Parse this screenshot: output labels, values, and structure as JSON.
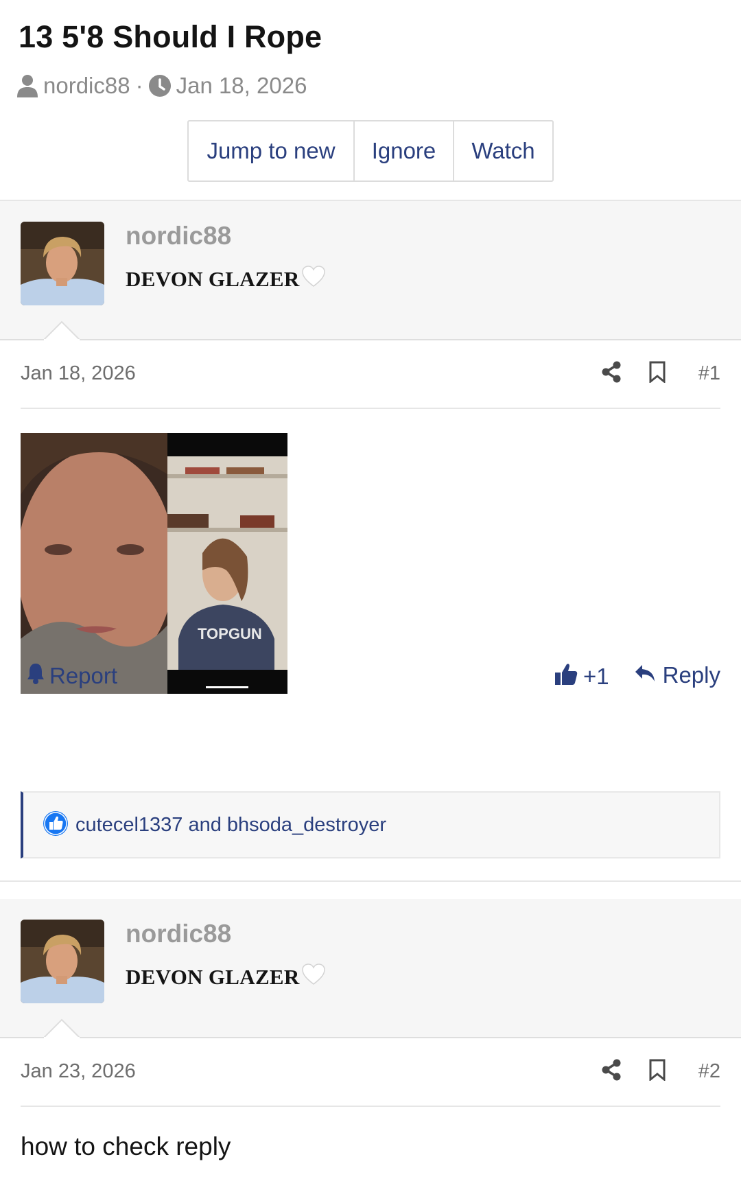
{
  "thread": {
    "title": "13 5'8 Should I Rope",
    "author": "nordic88",
    "separator": "·",
    "date": "Jan 18, 2026",
    "buttons": {
      "jump_to_new": "Jump to new",
      "ignore": "Ignore",
      "watch": "Watch"
    }
  },
  "posts": [
    {
      "username": "nordic88",
      "user_title": "DEVON GLAZER",
      "user_title_emoji": "white-heart-icon",
      "date": "Jan 18, 2026",
      "number": "#1",
      "actions": {
        "report": "Report",
        "like": "+1",
        "reply": "Reply"
      },
      "reactions": "cutecel1337 and bhsoda_destroyer"
    },
    {
      "username": "nordic88",
      "user_title": "DEVON GLAZER",
      "user_title_emoji": "white-heart-icon",
      "date": "Jan 23, 2026",
      "number": "#2",
      "body": "how to check reply"
    }
  ],
  "colors": {
    "link": "#2a3f7e",
    "muted": "#8a8a8a",
    "user_block_bg": "#f6f6f6",
    "reaction_blue": "#1877f2"
  }
}
